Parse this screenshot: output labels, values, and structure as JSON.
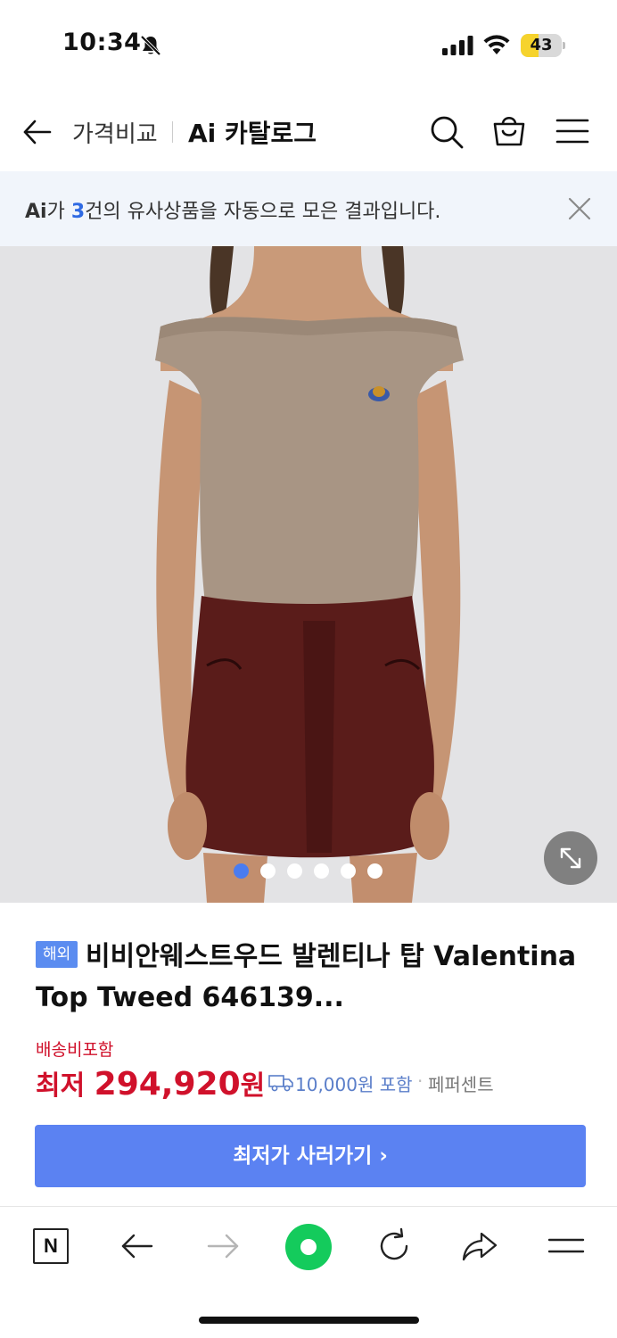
{
  "status_bar": {
    "time": "10:34",
    "battery_level": "43",
    "battery_fraction": 0.43,
    "icons": [
      "bell-slash-icon",
      "cellular-signal-icon",
      "wifi-icon",
      "battery-icon"
    ]
  },
  "header": {
    "nav_label": "가격비교",
    "title": "Ai 카탈로그",
    "icons": [
      "back-arrow-icon",
      "search-icon",
      "shopping-bag-icon",
      "hamburger-menu-icon"
    ]
  },
  "notice": {
    "ai_label": "Ai",
    "prefix": "가 ",
    "count": "3",
    "suffix": "건의 유사상품을 자동으로 모은 결과입니다.",
    "close_icon": "close-icon"
  },
  "gallery": {
    "image_description_icon": "product-photo",
    "slide_count": 6,
    "active_slide": 1,
    "expand_icon": "expand-icon"
  },
  "product": {
    "badge": "해외",
    "title": "비비안웨스트우드 발렌티나 탑 Valentina Top Tweed 646139...",
    "shipping_label": "배송비포함",
    "price_prefix": "최저 ",
    "price": "294,920",
    "price_unit": "원",
    "shipping_fee": "10,000원 포함",
    "separator": "·",
    "seller": "페퍼센트",
    "cta_label": "최저가 사러가기 ›"
  },
  "toolbar": {
    "naver_label": "N",
    "icons": [
      "naver-home-icon",
      "back-icon",
      "forward-icon",
      "green-circle-icon",
      "reload-icon",
      "share-icon",
      "menu-icon"
    ]
  },
  "colors": {
    "accent_blue": "#5b82f2",
    "price_red": "#d0112b",
    "badge_blue": "#5b8cf0",
    "naver_green": "#14cb5c",
    "battery_yellow": "#f6d32d"
  }
}
